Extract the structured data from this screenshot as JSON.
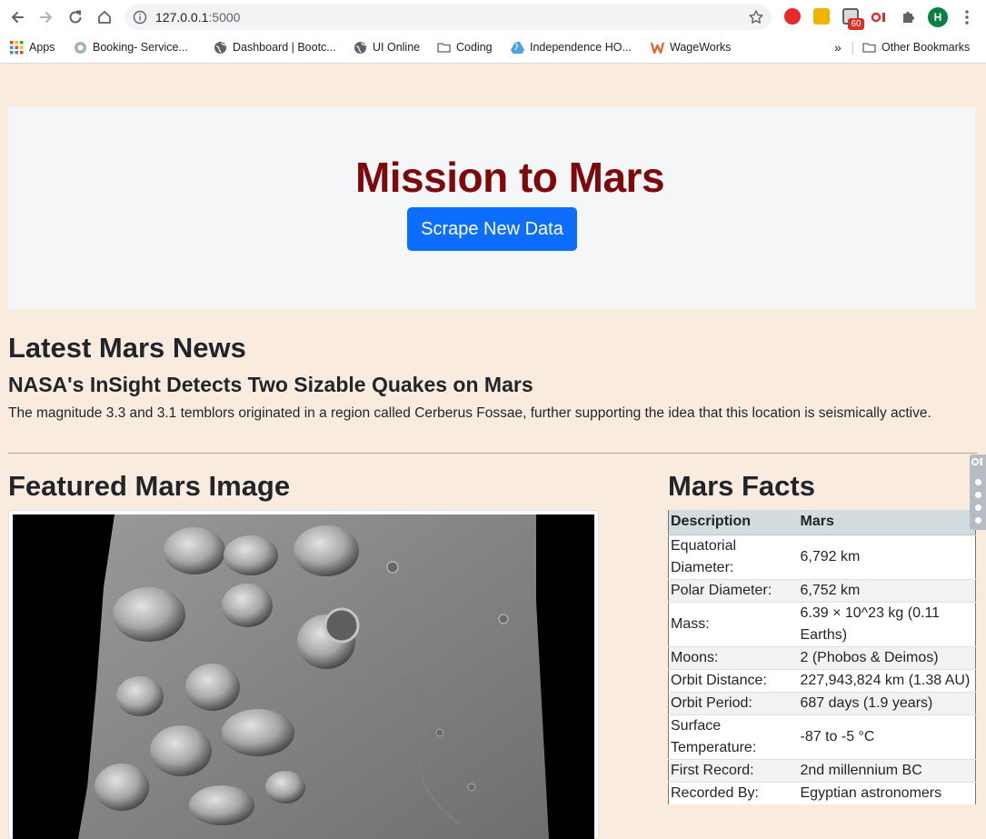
{
  "browser": {
    "url_host": "127.0.0.1",
    "url_port": ":5000",
    "extension_badge": "60",
    "profile_initial": "H",
    "bookmarks": [
      {
        "label": "Apps",
        "icon": "apps-grid-icon"
      },
      {
        "label": "Booking- Service...",
        "icon": "booking-icon"
      },
      {
        "label": "Dashboard | Bootc...",
        "icon": "globe-icon"
      },
      {
        "label": "UI Online",
        "icon": "globe-icon"
      },
      {
        "label": "Coding",
        "icon": "folder-icon"
      },
      {
        "label": "Independence HO...",
        "icon": "drive-icon"
      },
      {
        "label": "WageWorks",
        "icon": "wageworks-icon"
      }
    ],
    "overflow_label": "»",
    "other_bookmarks": "Other Bookmarks"
  },
  "hero": {
    "title": "Mission to Mars",
    "button_label": "Scrape New Data"
  },
  "news": {
    "heading": "Latest Mars News",
    "title": "NASA's InSight Detects Two Sizable Quakes on Mars",
    "paragraph": "The magnitude 3.3 and 3.1 temblors originated in a region called Cerberus Fossae, further supporting the idea that this location is seismically active."
  },
  "featured_image": {
    "heading": "Featured Mars Image"
  },
  "facts": {
    "heading": "Mars Facts",
    "columns": [
      "Description",
      "Mars"
    ],
    "rows": [
      [
        "Equatorial Diameter:",
        "6,792 km"
      ],
      [
        "Polar Diameter:",
        "6,752 km"
      ],
      [
        "Mass:",
        "6.39 × 10^23 kg (0.11 Earths)"
      ],
      [
        "Moons:",
        "2 (Phobos & Deimos)"
      ],
      [
        "Orbit Distance:",
        "227,943,824 km (1.38 AU)"
      ],
      [
        "Orbit Period:",
        "687 days (1.9 years)"
      ],
      [
        "Surface Temperature:",
        "-87 to -5 °C"
      ],
      [
        "First Record:",
        "2nd millennium BC"
      ],
      [
        "Recorded By:",
        "Egyptian astronomers"
      ]
    ]
  },
  "colors": {
    "page_bg": "#faebdf",
    "title_red": "#7d0a0a",
    "button_blue": "#0d6efd"
  }
}
